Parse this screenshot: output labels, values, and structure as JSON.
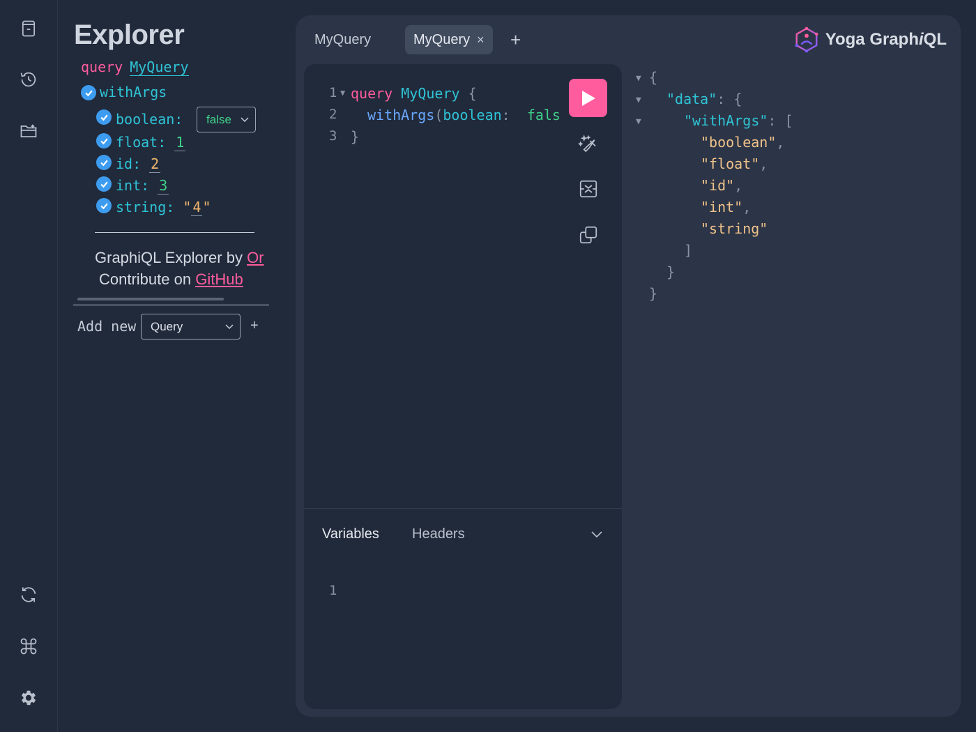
{
  "rail": {
    "icons": [
      "docs-icon",
      "history-icon",
      "explorer-icon",
      "refetch-schema-icon",
      "shortcuts-icon",
      "settings-icon"
    ]
  },
  "explorer": {
    "title": "Explorer",
    "operation_keyword": "query",
    "operation_name": "MyQuery",
    "field": "withArgs",
    "args": {
      "boolean_label": "boolean:",
      "boolean_value": "false",
      "float_label": "float:",
      "float_value": "1",
      "id_label": "id:",
      "id_value": "2",
      "int_label": "int:",
      "int_value": "3",
      "string_label": "string:",
      "string_quote_open": "\"",
      "string_value": "4",
      "string_quote_close": "\""
    },
    "credit_line1": "GraphiQL Explorer by ",
    "credit_link1": "Or",
    "credit_line2": "Contribute on ",
    "credit_link2": "GitHub",
    "add_new_label": "Add new",
    "add_new_selected": "Query",
    "add_button": "+"
  },
  "tabs": [
    {
      "label": "MyQuery",
      "active": false
    },
    {
      "label": "MyQuery",
      "active": true,
      "close": "×"
    }
  ],
  "new_tab_label": "+",
  "logo": {
    "text": "Yoga Graph",
    "text_italic": "i",
    "text_end": "QL"
  },
  "editor": {
    "line_numbers": [
      "1",
      "2",
      "3"
    ],
    "line1": {
      "kw": "query",
      "name": "MyQuery",
      "brace": "{"
    },
    "line2": {
      "field": "withArgs",
      "paren": "(",
      "arg": "boolean",
      "colon": ":",
      "value": "fals"
    },
    "line3": {
      "brace": "}"
    },
    "variables_tab": "Variables",
    "headers_tab": "Headers",
    "variables_line_number": "1"
  },
  "result": {
    "lines": [
      {
        "tri": "▼",
        "text": "{"
      },
      {
        "tri": "▼",
        "key": "\"data\"",
        "rest": ": {"
      },
      {
        "tri": "▼",
        "key": "\"withArgs\"",
        "rest": ": ["
      },
      {
        "str": "\"boolean\"",
        "rest": ","
      },
      {
        "str": "\"float\"",
        "rest": ","
      },
      {
        "str": "\"id\"",
        "rest": ","
      },
      {
        "str": "\"int\"",
        "rest": ","
      },
      {
        "str": "\"string\"",
        "rest": ""
      },
      {
        "text": "]"
      },
      {
        "text": "}"
      },
      {
        "text": "}"
      }
    ]
  },
  "colors": {
    "accent_pink": "#ff5c9d",
    "cyan": "#2ec4d6",
    "check_blue": "#3d9cf0",
    "background": "#212a3b",
    "card": "#2c3547"
  }
}
